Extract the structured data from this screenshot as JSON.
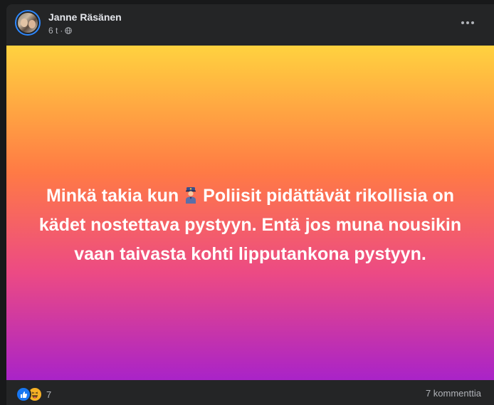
{
  "post": {
    "author": "Janne Räsänen",
    "time": "6 t",
    "separator": "·",
    "privacy_icon": "globe-icon",
    "more_icon": "more-options-icon"
  },
  "card": {
    "text_before_emoji": "Minkä takia kun",
    "emoji": "police-officer-emoji",
    "text_after_emoji": "Poliisit pidättävät rikollisia on kädet nostettava pystyyn. Entä jos muna nousikin vaan taivasta kohti lipputankona pystyyn.",
    "gradient_colors": [
      "#ffd23f",
      "#ff7a45",
      "#ec4a84",
      "#a923c8"
    ]
  },
  "footer": {
    "reaction_icons": [
      "like-icon",
      "haha-icon"
    ],
    "reaction_count": "7",
    "comments_label": "7 kommenttia"
  },
  "colors": {
    "background": "#18191a",
    "surface": "#242526",
    "primary_text": "#e4e6eb",
    "secondary_text": "#b0b3b8",
    "like_blue": "#1877f2",
    "haha_yellow": "#f7b125"
  }
}
